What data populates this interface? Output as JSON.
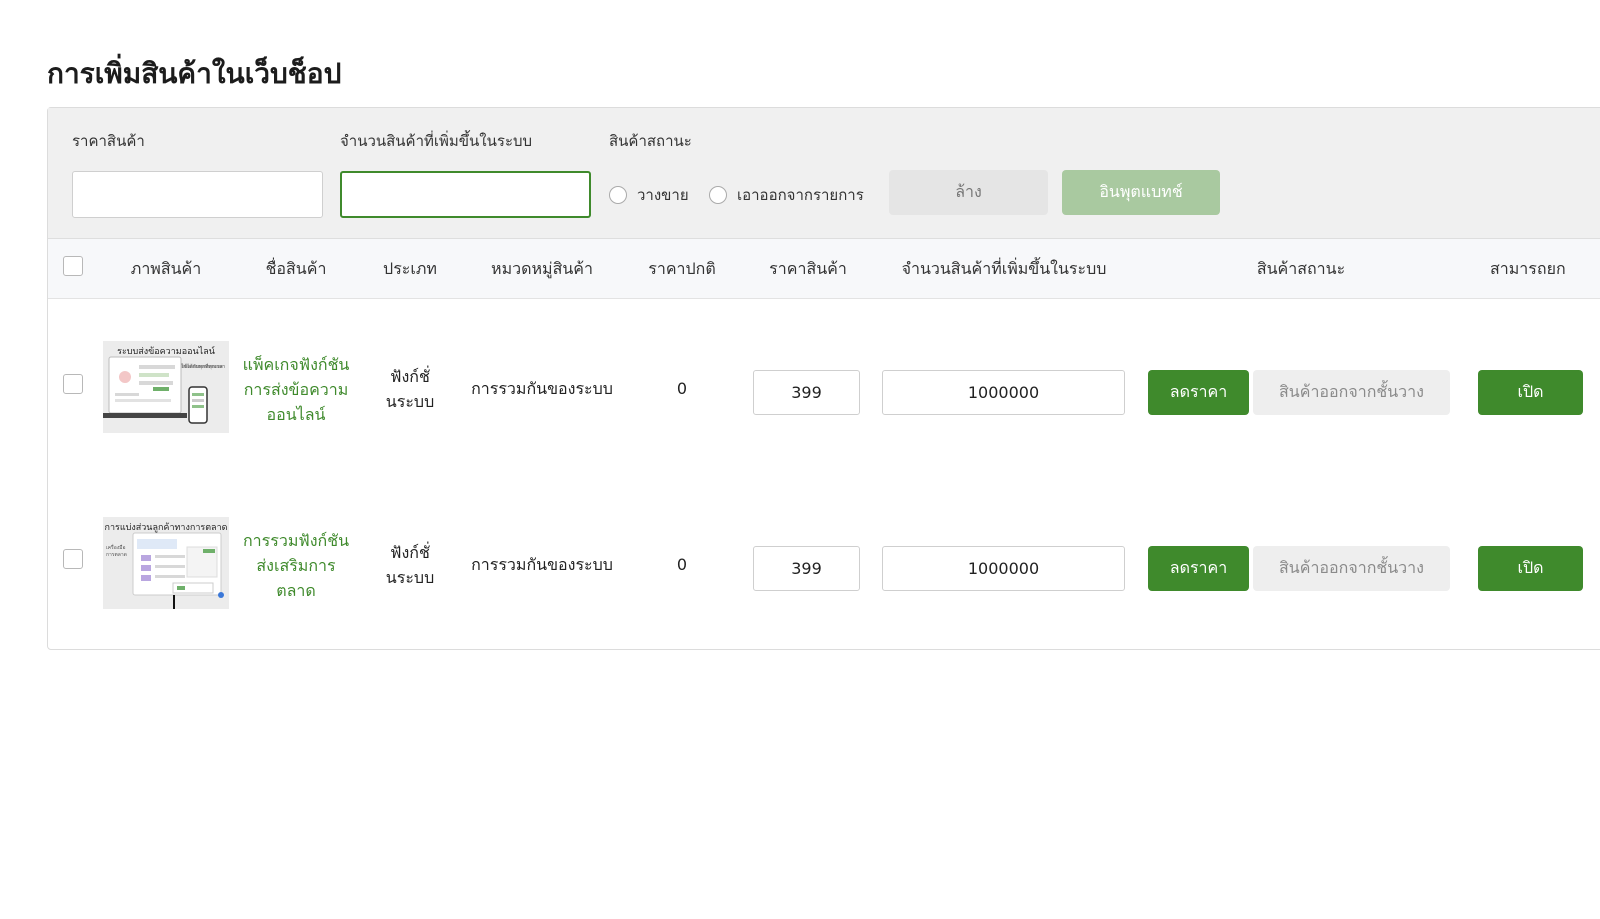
{
  "page": {
    "title": "การเพิ่มสินค้าในเว็บช็อป"
  },
  "filters": {
    "price_label": "ราคาสินค้า",
    "price_value": "",
    "qty_label": "จำนวนสินค้าที่เพิ่มขึ้นในระบบ",
    "qty_value": "",
    "status_label": "สินค้าสถานะ",
    "status_options": [
      "วางขาย",
      "เอาออกจากรายการ"
    ],
    "clear_label": "ล้าง",
    "import_label": "อินพุตแบทช์"
  },
  "table": {
    "headers": {
      "image": "ภาพสินค้า",
      "name": "ชื่อสินค้า",
      "type": "ประเภท",
      "category": "หมวดหมู่สินค้า",
      "regular_price": "ราคาปกติ",
      "price": "ราคาสินค้า",
      "qty": "จำนวนสินค้าที่เพิ่มขึ้นในระบบ",
      "status": "สินค้าสถานะ",
      "available": "สามารถยก"
    },
    "rows": [
      {
        "thumb_title": "ระบบส่งข้อความออนไลน์",
        "thumb_sub": "ใช้ได้กับทุกที่ทุกเวลา",
        "name": "แพ็คเกจฟังก์ชันการส่งข้อความออนไลน์",
        "type": "ฟังก์ชั่นระบบ",
        "category": "การรวมกันของระบบ",
        "regular_price": "0",
        "price": "399",
        "qty": "1000000",
        "discount_label": "ลดราคา",
        "off_shelf_label": "สินค้าออกจากชั้นวาง",
        "open_label": "เปิด"
      },
      {
        "thumb_title": "การแบ่งส่วนลูกค้าทางการตลาด",
        "thumb_sub": "เครื่องมือการตลาด",
        "name": "การรวมฟังก์ชันส่งเสริมการตลาด",
        "type": "ฟังก์ชั่นระบบ",
        "category": "การรวมกันของระบบ",
        "regular_price": "0",
        "price": "399",
        "qty": "1000000",
        "discount_label": "ลดราคา",
        "off_shelf_label": "สินค้าออกจากชั้นวาง",
        "open_label": "เปิด"
      }
    ]
  },
  "colors": {
    "accent": "#3f8a2c",
    "accent_disabled": "#a9c9a0",
    "filter_bg": "#f0f0f0"
  }
}
